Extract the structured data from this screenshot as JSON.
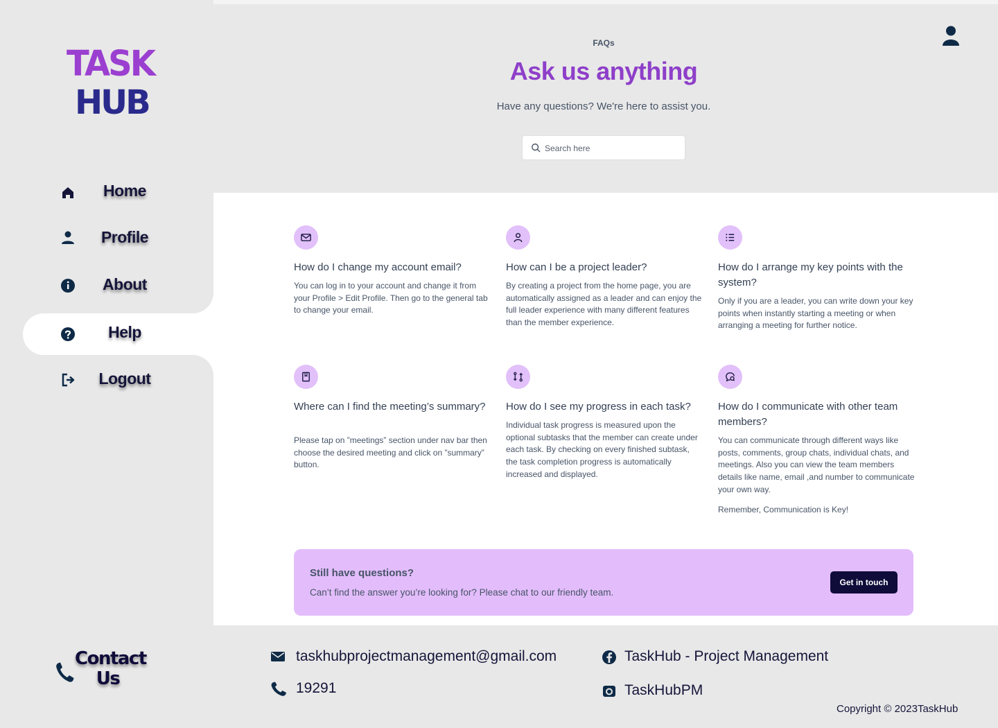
{
  "brand": {
    "logo_line1": "TASK",
    "logo_line2": "HUB"
  },
  "sidebar": {
    "items": [
      {
        "label": "Home",
        "icon": "home-icon"
      },
      {
        "label": "Profile",
        "icon": "user-icon"
      },
      {
        "label": "About",
        "icon": "info-icon"
      },
      {
        "label": "Help",
        "icon": "help-icon",
        "active": true
      },
      {
        "label": "Logout",
        "icon": "logout-icon"
      }
    ]
  },
  "header": {
    "eyebrow": "FAQs",
    "title": "Ask us anything",
    "subtitle": "Have any questions? We're here to assist you.",
    "search_placeholder": "Search here"
  },
  "faqs": [
    {
      "icon": "mail-icon",
      "question": "How do I change my account email?",
      "answer": "You can log in to your account and change it from your Profile > Edit Profile. Then go to the general tab to change your email."
    },
    {
      "icon": "user-icon",
      "question": "How can I be a project leader?",
      "answer": "By creating a project from the home page, you are automatically assigned as a leader and can enjoy the full leader experience with many different features than the member experience."
    },
    {
      "icon": "list-icon",
      "question": "How do I arrange my key points with the system?",
      "answer": "Only if you are a leader, you can write down your key points when instantly starting a meeting or when arranging a meeting for further notice."
    },
    {
      "icon": "bookmark-icon",
      "question": "Where can I find the meeting’s summary?",
      "answer": "Please tap on ”meetings” section under nav bar then choose the desired meeting and click on ”summary” button."
    },
    {
      "icon": "git-pull-icon",
      "question": "How do I see my progress in each task?",
      "answer": "Individual task progress is measured upon the optional subtasks that the member can create under each task. By checking on every finished subtask, the task completion progress is automatically increased and displayed."
    },
    {
      "icon": "chat-icon",
      "question": "How do I communicate with other team members?",
      "answer": "You can communicate through different ways like posts, comments, group chats, individual chats, and meetings. Also you can view the team members details like name, email ,and number to communicate your own way.",
      "extra": "Remember, Communication is Key!"
    }
  ],
  "cta": {
    "title": "Still have questions?",
    "text": "Can’t find the answer you’re looking for? Please chat to our friendly team.",
    "button": "Get in touch"
  },
  "footer": {
    "contact_title": "Contact Us",
    "email": "taskhubprojectmanagement@gmail.com",
    "phone": "19291",
    "facebook": "TaskHub - Project Management",
    "instagram": "TaskHubPM",
    "copyright": "Copyright © 2023TaskHub"
  },
  "colors": {
    "accent": "#8e3fc9",
    "dark": "#0f0c3a",
    "badge": "#e2c0fa",
    "cta_bg": "#e3bdfb"
  }
}
